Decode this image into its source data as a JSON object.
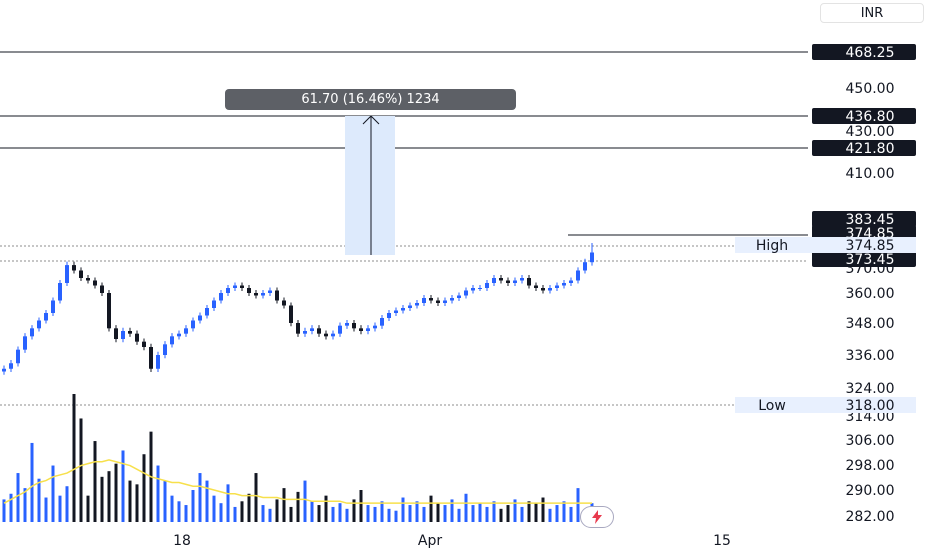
{
  "currency": "INR",
  "measure": {
    "label": "61.70 (16.46%) 1234",
    "from": 373.45,
    "to": 436.8,
    "x_from": "Mar 28",
    "x_to": "Mar 29"
  },
  "price_scale": {
    "ticks": [
      "450.00",
      "430.00",
      "410.00",
      "370.00",
      "360.00",
      "348.00",
      "336.00",
      "324.00",
      "314.00",
      "306.00",
      "298.00",
      "290.00",
      "282.00"
    ]
  },
  "horizontal_lines": [
    {
      "label": "468.25",
      "value": 468.25
    },
    {
      "label": "436.80",
      "value": 436.8
    },
    {
      "label": "421.80",
      "value": 421.8
    }
  ],
  "price_labels": [
    {
      "label": "383.45",
      "value": 383.45
    },
    {
      "label": "374.85",
      "value": 374.85
    },
    {
      "label": "373.45",
      "value": 373.45
    }
  ],
  "high": {
    "label": "High",
    "value_label": "374.85",
    "value": 374.85
  },
  "low": {
    "label": "Low",
    "value_label": "318.00",
    "value": 318.0
  },
  "x_axis": {
    "labels": [
      "18",
      "Apr",
      "15"
    ]
  },
  "colors": {
    "up": "#2962ff",
    "down": "#131722",
    "volume_ma": "#f7e04b",
    "measure_fill": "#ddeafc",
    "line": "#131722",
    "high_low_bg": "#e8f0fe"
  },
  "chart_data": {
    "type": "candlestick",
    "series": [
      {
        "name": "",
        "values": [
          331,
          333,
          338,
          343,
          346,
          349,
          352,
          357,
          364,
          371,
          369,
          366,
          365,
          363,
          360,
          346,
          342,
          345,
          344,
          341,
          339,
          331,
          336,
          340,
          343,
          344,
          346,
          349,
          351,
          354,
          357,
          360,
          362,
          363,
          362,
          360,
          359,
          360,
          361,
          357,
          355,
          348,
          344,
          345,
          346,
          344,
          343,
          344,
          347,
          348,
          346,
          345,
          346,
          347,
          350,
          352,
          353,
          354,
          355,
          356,
          358,
          357,
          356,
          357,
          358,
          359,
          361,
          362,
          362,
          364,
          366,
          365,
          364,
          365,
          366,
          363,
          362,
          361,
          362,
          363,
          364,
          365,
          369,
          372,
          374
        ]
      }
    ],
    "volume": [
      12,
      15,
      26,
      18,
      42,
      23,
      13,
      30,
      14,
      19,
      68,
      55,
      14,
      43,
      24,
      27,
      31,
      38,
      22,
      20,
      36,
      48,
      30,
      22,
      14,
      11,
      9,
      17,
      26,
      22,
      14,
      10,
      20,
      8,
      11,
      15,
      26,
      9,
      7,
      12,
      18,
      8,
      16,
      22,
      11,
      9,
      14,
      8,
      10,
      7,
      12,
      17,
      9,
      8,
      11,
      7,
      6,
      13,
      9,
      11,
      8,
      14,
      10,
      9,
      12,
      7,
      15,
      9,
      10,
      8,
      11,
      7,
      9,
      12,
      8,
      11,
      10,
      13,
      7,
      9,
      11,
      8,
      18,
      6,
      10
    ],
    "volume_ma": [
      10,
      12,
      14,
      16,
      19,
      21,
      22,
      24,
      25,
      26,
      28,
      30,
      31,
      32,
      32,
      33,
      32,
      31,
      30,
      28,
      26,
      24,
      23,
      22,
      21,
      21,
      20,
      19,
      19,
      18,
      17,
      16,
      15,
      15,
      14,
      14,
      14,
      13,
      13,
      13,
      12,
      12,
      12,
      12,
      11,
      11,
      11,
      11,
      11,
      10,
      10,
      10,
      10,
      10,
      10,
      10,
      10,
      10,
      10,
      10,
      10,
      10,
      10,
      10,
      10,
      10,
      10,
      10,
      10,
      10,
      10,
      10,
      10,
      10,
      10,
      10,
      10,
      10,
      10,
      10,
      10,
      10,
      10,
      10,
      10
    ],
    "ylim": [
      282,
      470
    ]
  }
}
